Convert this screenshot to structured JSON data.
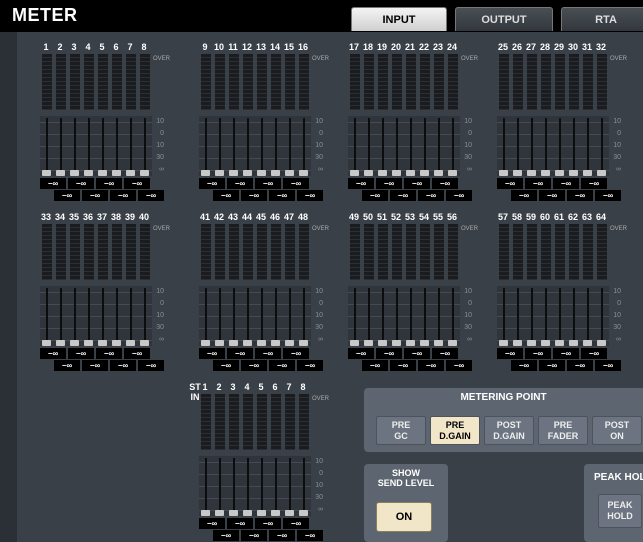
{
  "window": {
    "title": "METER"
  },
  "tabs": [
    {
      "label": "INPUT",
      "active": true
    },
    {
      "label": "OUTPUT",
      "active": false
    },
    {
      "label": "RTA",
      "active": false
    }
  ],
  "meter_label": {
    "over": "OVER"
  },
  "fader_scale": [
    "10",
    "0",
    "10",
    "30",
    "∞"
  ],
  "level_value": "−∞",
  "channel_groups": [
    {
      "channels": [
        "1",
        "2",
        "3",
        "4",
        "5",
        "6",
        "7",
        "8"
      ]
    },
    {
      "channels": [
        "9",
        "10",
        "11",
        "12",
        "13",
        "14",
        "15",
        "16"
      ]
    },
    {
      "channels": [
        "17",
        "18",
        "19",
        "20",
        "21",
        "22",
        "23",
        "24"
      ]
    },
    {
      "channels": [
        "25",
        "26",
        "27",
        "28",
        "29",
        "30",
        "31",
        "32"
      ]
    },
    {
      "channels": [
        "33",
        "34",
        "35",
        "36",
        "37",
        "38",
        "39",
        "40"
      ]
    },
    {
      "channels": [
        "41",
        "42",
        "43",
        "44",
        "45",
        "46",
        "47",
        "48"
      ]
    },
    {
      "channels": [
        "49",
        "50",
        "51",
        "52",
        "53",
        "54",
        "55",
        "56"
      ]
    },
    {
      "channels": [
        "57",
        "58",
        "59",
        "60",
        "61",
        "62",
        "63",
        "64"
      ]
    }
  ],
  "st_in": {
    "label": "ST IN",
    "channels": [
      "1",
      "2",
      "3",
      "4",
      "5",
      "6",
      "7",
      "8"
    ]
  },
  "metering_point": {
    "title": "METERING POINT",
    "options": [
      "PRE\nGC",
      "PRE\nD.GAIN",
      "POST\nD.GAIN",
      "PRE\nFADER",
      "POST\nON"
    ],
    "selected": "PRE\nD.GAIN"
  },
  "send_level": {
    "title": "SHOW\nSEND LEVEL",
    "button": "ON"
  },
  "peak_hold": {
    "title": "PEAK HOLD",
    "button": "PEAK\nHOLD"
  }
}
